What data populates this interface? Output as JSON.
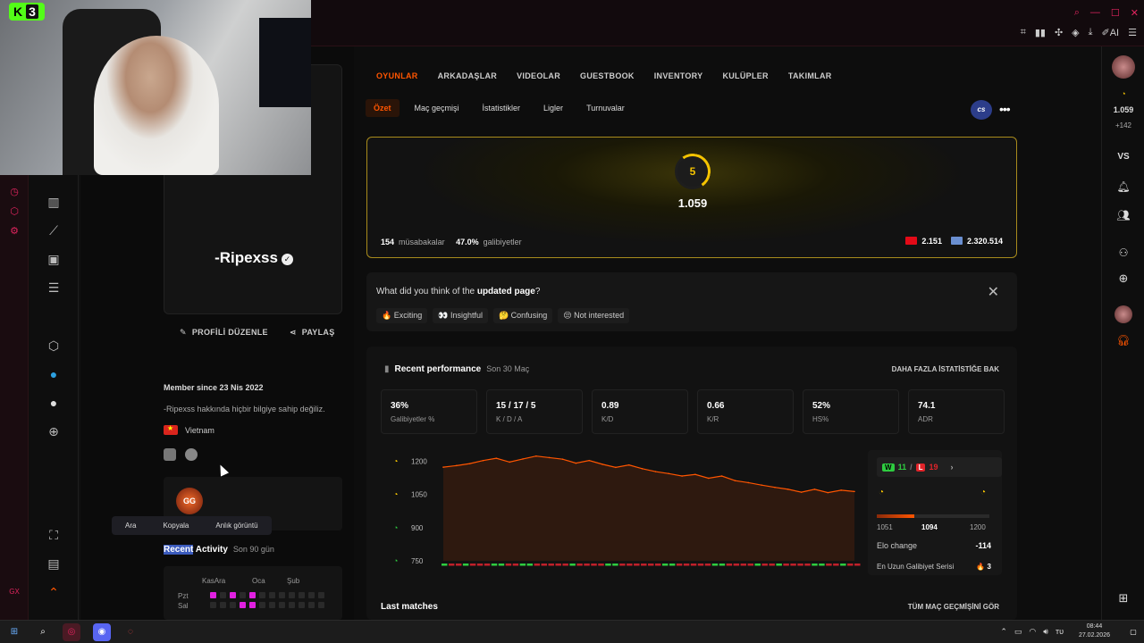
{
  "webcam": {
    "logo_letter": "K",
    "logo_num": "3"
  },
  "topbar": {
    "ai_label": "AI"
  },
  "profile": {
    "username": "-Ripexss",
    "edit_label": "PROFİLİ DÜZENLE",
    "share_label": "PAYLAŞ",
    "member_since": "Member since 23 Nis 2022",
    "no_info": "-Ripexss hakkında hiçbir bilgiye sahip değiliz.",
    "country": "Vietnam",
    "badge_text": "GG",
    "context_menu": [
      "Ara",
      "Kopyala",
      "Anlık görüntü"
    ],
    "recent_activity_hl": "Recent",
    "recent_activity_rest": " Activity",
    "recent_activity_sub": "Son 90 gün",
    "heatmap_months": [
      "KasAra",
      "Oca",
      "Şub"
    ],
    "heatmap_days": [
      "Pzt",
      "Sal"
    ]
  },
  "tabs": [
    "OYUNLAR",
    "ARKADAŞLAR",
    "VIDEOLAR",
    "GUESTBOOK",
    "INVENTORY",
    "KULÜPLER",
    "TAKIMLAR"
  ],
  "subtabs": [
    "Özet",
    "Maç geçmişi",
    "İstatistikler",
    "Ligler",
    "Turnuvalar"
  ],
  "game_badge": "cs",
  "elo_card": {
    "level": "5",
    "elo": "1.059",
    "matches_num": "154",
    "matches_label": "müsabakalar",
    "winrate_num": "47.0%",
    "winrate_label": "galibiyetler",
    "country_rank": "2.151",
    "region_rank": "2.320.514"
  },
  "feedback": {
    "question_pre": "What did you think of the ",
    "question_bold": "updated page",
    "question_post": "?",
    "options": [
      "🔥 Exciting",
      "👀 Insightful",
      "🤔 Confusing",
      "😒 Not interested"
    ]
  },
  "performance": {
    "title": "Recent performance",
    "subtitle": "Son 30 Maç",
    "more_link": "DAHA FAZLA İSTATİSTİĞE BAK",
    "stats": [
      {
        "value": "36%",
        "label": "Galibiyetler %"
      },
      {
        "value": "15 / 17 / 5",
        "label": "K / D / A"
      },
      {
        "value": "0.89",
        "label": "K/D"
      },
      {
        "value": "0.66",
        "label": "K/R"
      },
      {
        "value": "52%",
        "label": "HS%"
      },
      {
        "value": "74.1",
        "label": "ADR"
      }
    ],
    "wins": "11",
    "losses": "19",
    "range_low": "1051",
    "range_current": "1094",
    "range_high": "1200",
    "elo_bar_fill": 0.33,
    "elo_change_label": "Elo change",
    "elo_change_value": "-114",
    "streak_label": "En Uzun Galibiyet Serisi",
    "streak_value": "🔥 3",
    "last_matches": "Last matches",
    "all_matches_link": "TÜM MAÇ GEÇMİŞİNİ GÖR"
  },
  "chart_data": {
    "type": "line",
    "ylim": [
      750,
      1250
    ],
    "y_ticks": [
      "1200",
      "1050",
      "900",
      "750"
    ],
    "series": [
      {
        "values": [
          1173,
          1180,
          1189,
          1203,
          1213,
          1196,
          1210,
          1223,
          1216,
          1209,
          1191,
          1203,
          1186,
          1172,
          1183,
          1166,
          1153,
          1144,
          1133,
          1140,
          1123,
          1133,
          1112,
          1103,
          1092,
          1082,
          1073,
          1060,
          1073,
          1058,
          1069,
          1063
        ]
      }
    ],
    "results": [
      "W",
      "L",
      "L",
      "W",
      "L",
      "L",
      "L",
      "W",
      "W",
      "L",
      "L",
      "W",
      "W",
      "L",
      "L",
      "L",
      "L",
      "L",
      "W",
      "L",
      "L",
      "L",
      "L",
      "W",
      "W",
      "L",
      "L",
      "L",
      "L",
      "L",
      "L",
      "W",
      "W",
      "L",
      "L",
      "L",
      "L",
      "L",
      "W",
      "W",
      "L",
      "L",
      "L",
      "L",
      "W",
      "L",
      "L",
      "W",
      "L",
      "L",
      "L",
      "L",
      "W",
      "W",
      "L",
      "L",
      "W",
      "L",
      "L"
    ]
  },
  "taskbar": {
    "time": "08:44",
    "date": "27.02.2026"
  },
  "right_bar": {
    "elo": "1.059",
    "elo_delta": "+142",
    "vs": "VS"
  }
}
